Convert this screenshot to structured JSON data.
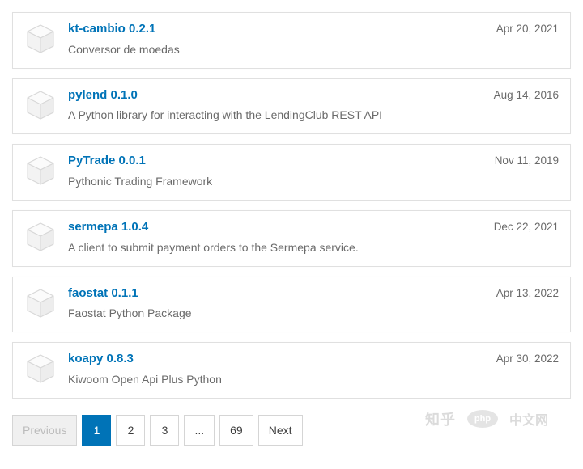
{
  "packages": [
    {
      "name": "kt-cambio 0.2.1",
      "description": "Conversor de moedas",
      "date": "Apr 20, 2021"
    },
    {
      "name": "pylend 0.1.0",
      "description": "A Python library for interacting with the LendingClub REST API",
      "date": "Aug 14, 2016"
    },
    {
      "name": "PyTrade 0.0.1",
      "description": "Pythonic Trading Framework",
      "date": "Nov 11, 2019"
    },
    {
      "name": "sermepa 1.0.4",
      "description": "A client to submit payment orders to the Sermepa service.",
      "date": "Dec 22, 2021"
    },
    {
      "name": "faostat 0.1.1",
      "description": "Faostat Python Package",
      "date": "Apr 13, 2022"
    },
    {
      "name": "koapy 0.8.3",
      "description": "Kiwoom Open Api Plus Python",
      "date": "Apr 30, 2022"
    }
  ],
  "pagination": {
    "previous_label": "Previous",
    "next_label": "Next",
    "pages": [
      "1",
      "2",
      "3",
      "...",
      "69"
    ],
    "active": "1",
    "previous_disabled": true
  },
  "watermark": {
    "zhihu": "知乎",
    "php": "php",
    "cn": "中文网"
  }
}
